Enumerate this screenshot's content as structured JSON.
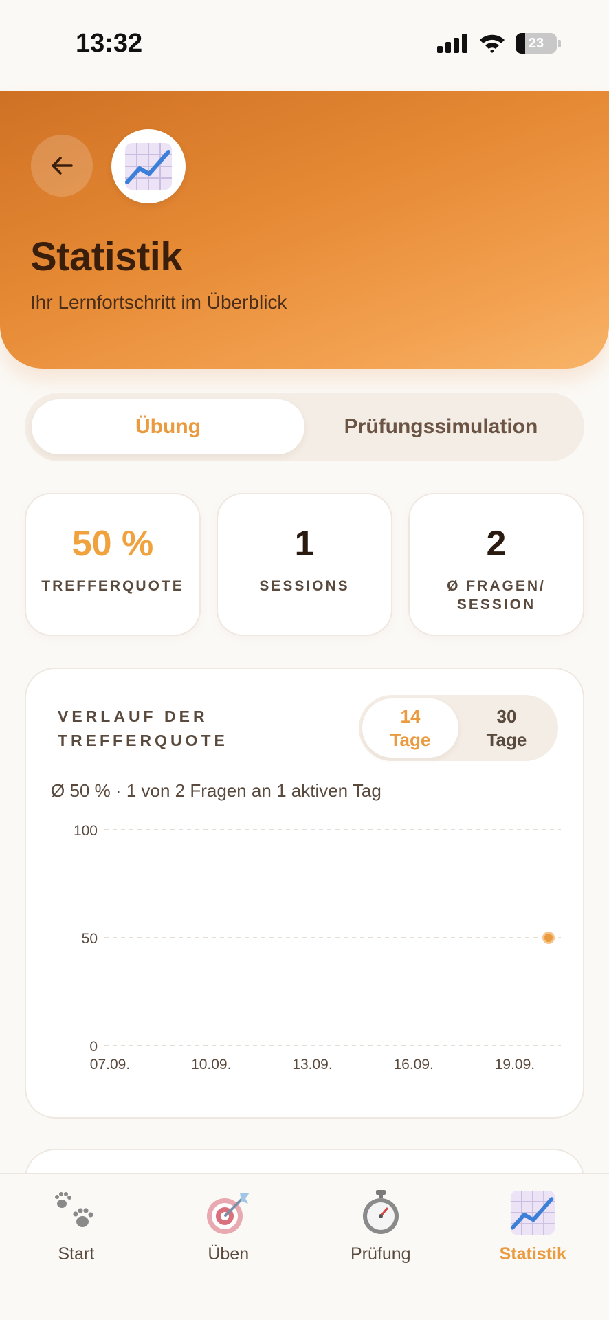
{
  "status_bar": {
    "time": "13:32",
    "battery": "23"
  },
  "header": {
    "title": "Statistik",
    "subtitle": "Ihr Lernfortschritt im Überblick",
    "icon": "chart-increasing-icon"
  },
  "tabs": [
    {
      "label": "Übung",
      "active": true
    },
    {
      "label": "Prüfungssimulation",
      "active": false
    }
  ],
  "stats": [
    {
      "value": "50 %",
      "label": "TREFFERQUOTE"
    },
    {
      "value": "1",
      "label": "SESSIONS"
    },
    {
      "value": "2",
      "label": "Ø FRAGEN/ SESSION"
    }
  ],
  "chart_card": {
    "heading": "VERLAUF DER TREFFERQUOTE",
    "range_options": [
      {
        "label": "14\nTage",
        "active": true
      },
      {
        "label": "30\nTage",
        "active": false
      }
    ],
    "summary": "Ø 50 % · 1 von 2 Fragen an 1 aktiven Tag"
  },
  "chart_data": {
    "type": "line",
    "x_ticks": [
      "07.09.",
      "10.09.",
      "13.09.",
      "16.09.",
      "19.09."
    ],
    "y_ticks": [
      "0",
      "50",
      "100"
    ],
    "ylim": [
      0,
      100
    ],
    "x_range": [
      "07.09.",
      "20.09."
    ],
    "points": [
      {
        "x": "20.09.",
        "y": 50
      }
    ],
    "grid": true,
    "colors": {
      "point": "#ea9a3f",
      "grid": "#e4ddd5"
    }
  },
  "nav": [
    {
      "label": "Start",
      "icon": "paw-prints-icon",
      "active": false
    },
    {
      "label": "Üben",
      "icon": "target-dart-icon",
      "active": false
    },
    {
      "label": "Prüfung",
      "icon": "stopwatch-icon",
      "active": false
    },
    {
      "label": "Statistik",
      "icon": "chart-increasing-icon",
      "active": true
    }
  ],
  "colors": {
    "accent": "#ea9a3f",
    "header_start": "#cf7124",
    "header_end": "#f8b468"
  }
}
